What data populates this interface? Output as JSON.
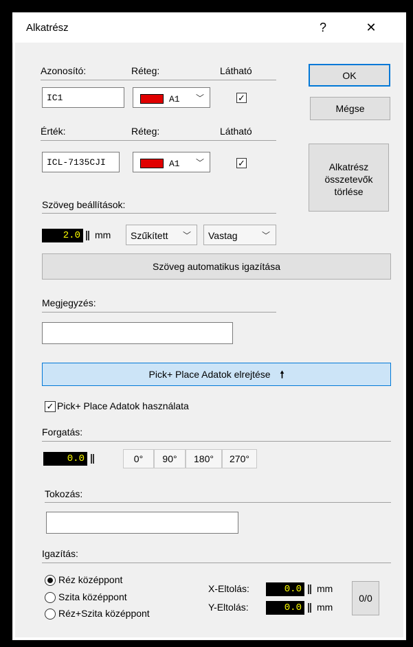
{
  "window": {
    "title": "Alkatrész",
    "help": "?",
    "close": "✕"
  },
  "id_row": {
    "label_id": "Azonosító:",
    "label_layer": "Réteg:",
    "label_visible": "Látható",
    "id_value": "IC1",
    "layer_value": "A1",
    "visible_checked": true
  },
  "value_row": {
    "label_value": "Érték:",
    "label_layer": "Réteg:",
    "label_visible": "Látható",
    "value": "ICL-7135CJI",
    "layer_value": "A1",
    "visible_checked": true
  },
  "buttons": {
    "ok": "OK",
    "cancel": "Mégse",
    "delete_parts": "Alkatrész összetevők törlése",
    "auto_align": "Szöveg automatikus igazítása",
    "pick_place_hide": "Pick+ Place Adatok elrejtése",
    "zero": "0/0"
  },
  "text_settings": {
    "label": "Szöveg beállítások:",
    "size": "2.0",
    "unit": "mm",
    "width_option": "Szűkített",
    "weight_option": "Vastag"
  },
  "comment": {
    "label": "Megjegyzés:",
    "value": ""
  },
  "pick_place": {
    "use_label": "Pick+ Place Adatok használata",
    "use_checked": true
  },
  "rotation": {
    "label": "Forgatás:",
    "value": "0.0",
    "presets": [
      "0°",
      "90°",
      "180°",
      "270°"
    ]
  },
  "package": {
    "label": "Tokozás:",
    "value": ""
  },
  "alignment": {
    "label": "Igazítás:",
    "options": [
      "Réz középpont",
      "Szita középpont",
      "Réz+Szita középpont"
    ],
    "selected": 0,
    "x_label": "X-Eltolás:",
    "x_value": "0.0",
    "y_label": "Y-Eltolás:",
    "y_value": "0.0",
    "unit": "mm"
  },
  "colors": {
    "layer_swatch": "#e00000",
    "pick_place_bg": "#cce4f7",
    "ok_border": "#0078d7",
    "number_fg": "#ffff00"
  }
}
